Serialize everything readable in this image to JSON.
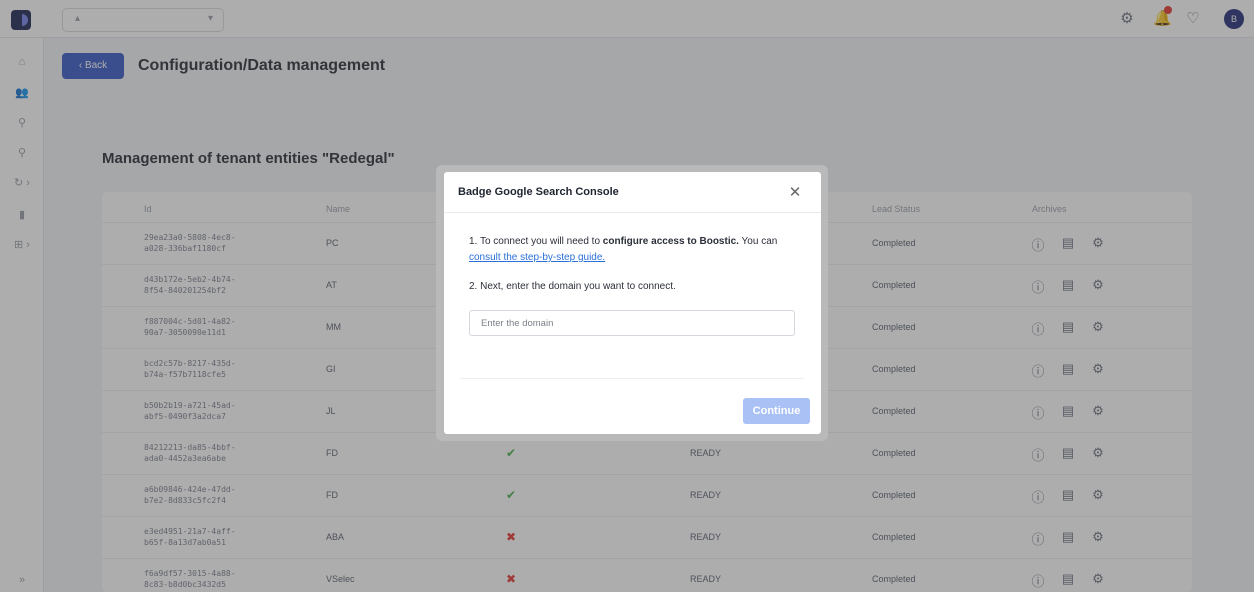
{
  "header": {
    "icons": [
      "settings-icon",
      "bell-icon",
      "lightbulb-icon"
    ],
    "avatar_initial": "B"
  },
  "sidebar": {
    "icons": [
      "home-icon",
      "users-icon",
      "search-icon",
      "search-icon",
      "refresh-icon",
      "chart-icon",
      "grid-icon",
      "collapse-icon"
    ]
  },
  "main": {
    "back_label": "Back",
    "page_title": "Configuration/Data management",
    "section_title": "Management of tenant entities \"Redegal\"",
    "columns": [
      "Id",
      "Name",
      "Lead Status",
      "Archives"
    ],
    "rows": [
      {
        "id": "29ea23a0-5808-4ec8-\na028-336baf1180cf",
        "name": "PC",
        "check": "",
        "status": "",
        "lead": "Completed"
      },
      {
        "id": "d43b172e-5eb2-4b74-\n8f54-840201254bf2",
        "name": "AT",
        "check": "",
        "status": "",
        "lead": "Completed"
      },
      {
        "id": "f887004c-5d01-4a82-\n90a7-3050090e11d1",
        "name": "MM",
        "check": "",
        "status": "",
        "lead": "Completed"
      },
      {
        "id": "bcd2c57b-8217-435d-\nb74a-f57b7118cfe5",
        "name": "GI",
        "check": "",
        "status": "",
        "lead": "Completed"
      },
      {
        "id": "b50b2b19-a721-45ad-\nabf5-0490f3a2dca7",
        "name": "JL",
        "check": "",
        "status": "",
        "lead": "Completed"
      },
      {
        "id": "84212213-da85-4bbf-\nada0-4452a3ea6abe",
        "name": "FD",
        "check": "✔",
        "status": "READY",
        "lead": "Completed"
      },
      {
        "id": "a6b09846-424e-47dd-\nb7e2-8d833c5fc2f4",
        "name": "FD",
        "check": "✔",
        "status": "READY",
        "lead": "Completed"
      },
      {
        "id": "e3ed4951-21a7-4aff-\nb65f-8a13d7ab0a51",
        "name": "ABA",
        "check": "✖",
        "status": "READY",
        "lead": "Completed"
      },
      {
        "id": "f6a9df57-3015-4a88-\n8c83-b8d0bc3432d5",
        "name": "VSelec",
        "check": "✖",
        "status": "READY",
        "lead": "Completed"
      }
    ]
  },
  "modal": {
    "title": "Badge Google Search Console",
    "step1_prefix": "1. To connect you will need to ",
    "step1_bold": "configure access to Boostic.",
    "step1_suffix": " You can ",
    "step1_link": "consult the step-by-step guide.",
    "step2": "2. Next, enter the domain you want to connect.",
    "domain_placeholder": "Enter the domain",
    "domain_value": "",
    "continue_label": "Continue"
  },
  "colors": {
    "primary": "#3a5bc7",
    "continue_disabled": "#a9c1f5",
    "link": "#2a6fdb",
    "check_green": "#4caf50",
    "cross_red": "#e53935"
  }
}
